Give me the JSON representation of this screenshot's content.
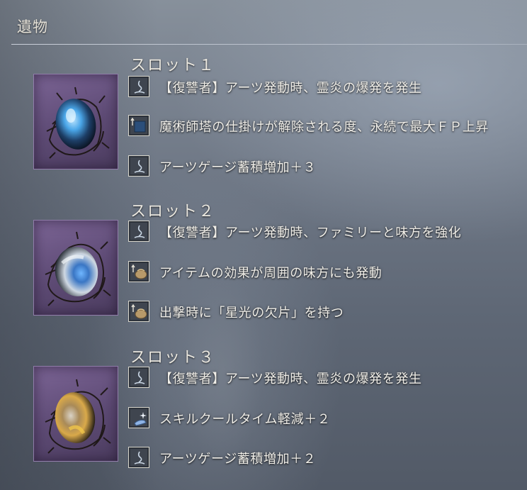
{
  "header": {
    "title": "遺物"
  },
  "slots": [
    {
      "title": "スロット１",
      "relic_icon": "relic-blue-gem-icon",
      "effects": [
        {
          "icon": "wind-swirl-icon",
          "text": "【復讐者】アーツ発動時、霊炎の爆発を発生"
        },
        {
          "icon": "blue-square-up-arrow-icon",
          "text": "魔術師塔の仕掛けが解除される度、永続で最大ＦＰ上昇"
        },
        {
          "icon": "wind-swirl-icon",
          "text": "アーツゲージ蓄積増加＋３"
        }
      ]
    },
    {
      "title": "スロット２",
      "relic_icon": "relic-white-gem-icon",
      "effects": [
        {
          "icon": "wind-swirl-icon",
          "text": "【復讐者】アーツ発動時、ファミリーと味方を強化"
        },
        {
          "icon": "pouch-up-arrow-icon",
          "text": "アイテムの効果が周囲の味方にも発動"
        },
        {
          "icon": "pouch-up-arrow-icon",
          "text": "出撃時に「星光の欠片」を持つ"
        }
      ]
    },
    {
      "title": "スロット３",
      "relic_icon": "relic-gold-gem-icon",
      "effects": [
        {
          "icon": "wind-swirl-icon",
          "text": "【復讐者】アーツ発動時、霊炎の爆発を発生"
        },
        {
          "icon": "sparkle-hand-icon",
          "text": "スキルクールタイム軽減＋２"
        },
        {
          "icon": "wind-swirl-icon",
          "text": "アーツゲージ蓄積増加＋２"
        }
      ]
    }
  ],
  "colors": {
    "background": "#6c7583",
    "relic_frame": "#6a5582",
    "text": "#f0eee8",
    "gem_blue": "#4aa6e8",
    "gem_white": "#c9d3de",
    "gem_gold": "#d9a94a"
  }
}
